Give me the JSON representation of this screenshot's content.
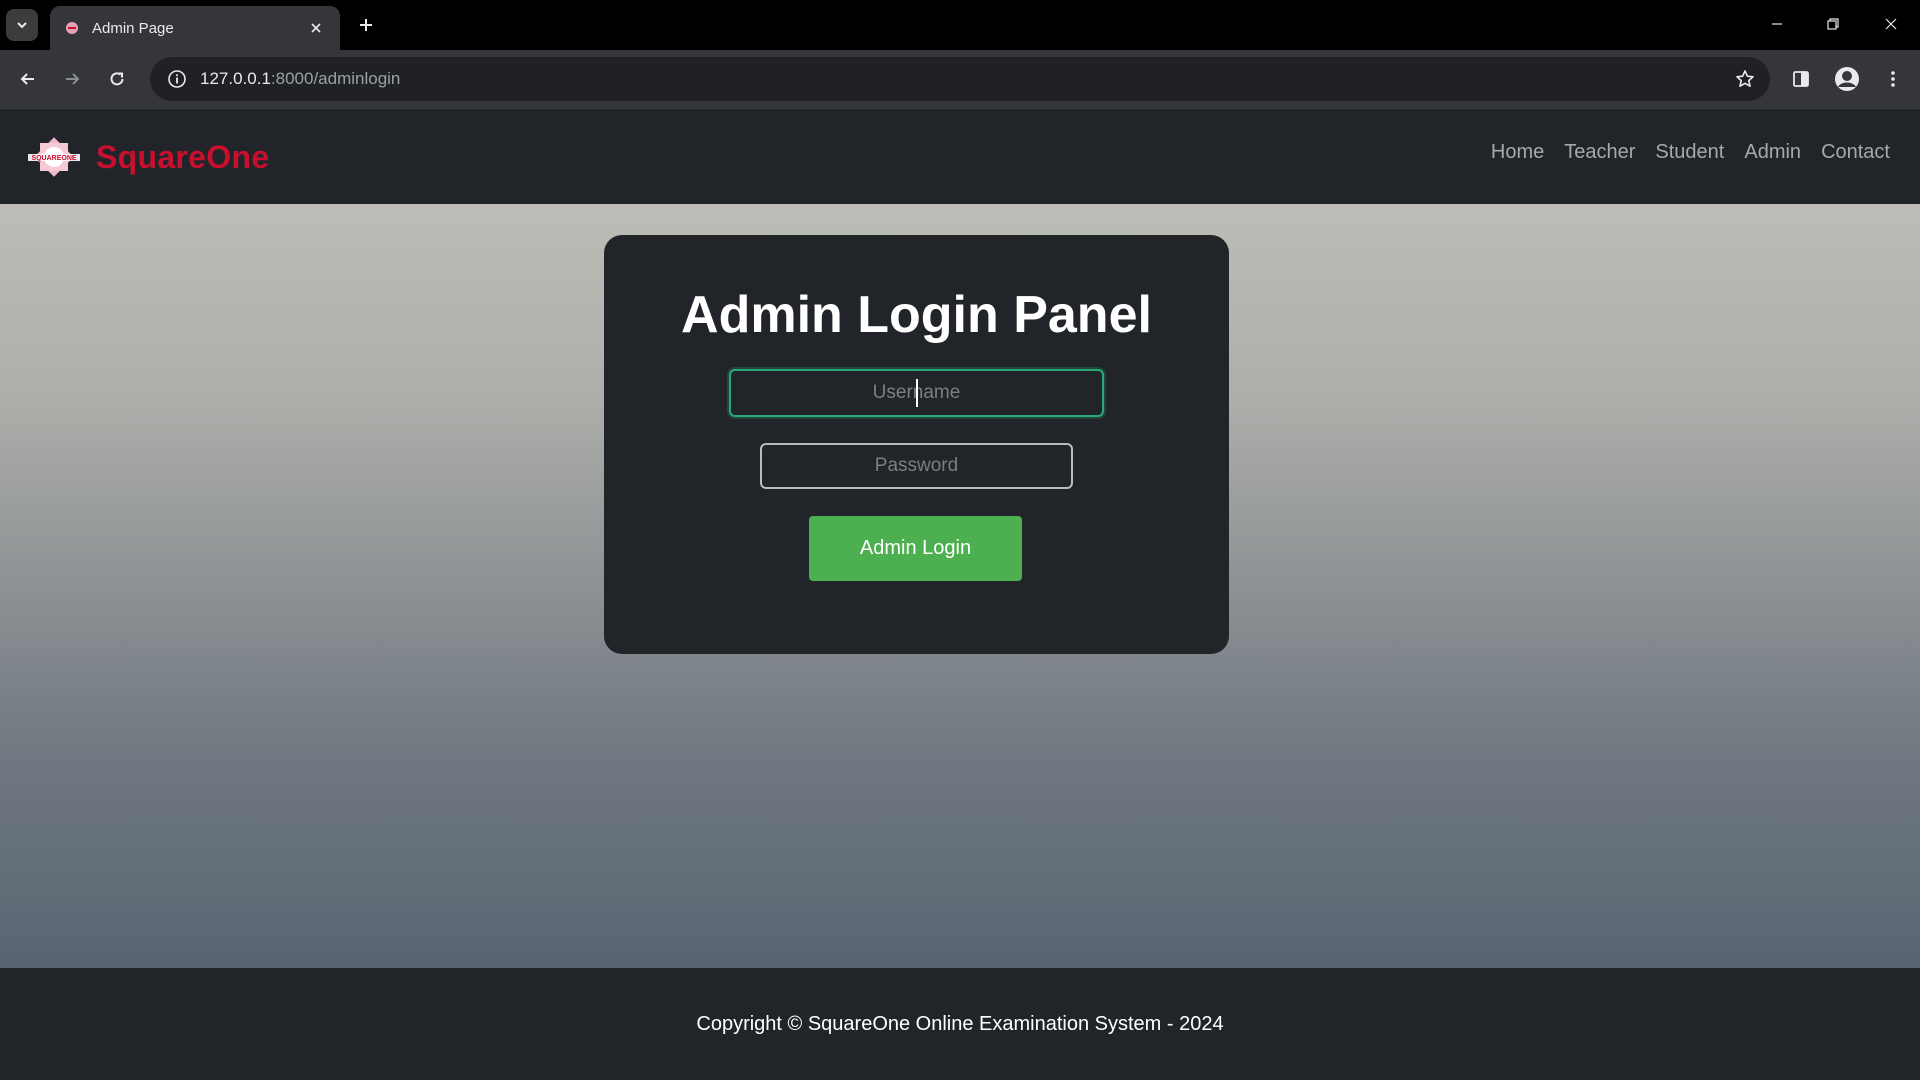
{
  "browser": {
    "tab": {
      "title": "Admin Page"
    },
    "address": {
      "host": "127.0.0.1",
      "rest": ":8000/adminlogin"
    }
  },
  "site": {
    "brand": {
      "name": "SquareOne",
      "logo_text": "SQUAREONE"
    },
    "nav": [
      "Home",
      "Teacher",
      "Student",
      "Admin",
      "Contact"
    ]
  },
  "login": {
    "title": "Admin Login Panel",
    "username_placeholder": "Username",
    "password_placeholder": "Password",
    "button_label": "Admin Login"
  },
  "footer": {
    "text": "Copyright © SquareOne Online Examination System - 2024"
  },
  "colors": {
    "brand": "#c8102e",
    "button": "#4caf50",
    "focus_border": "#2aa878",
    "nav_bg": "#212529"
  }
}
